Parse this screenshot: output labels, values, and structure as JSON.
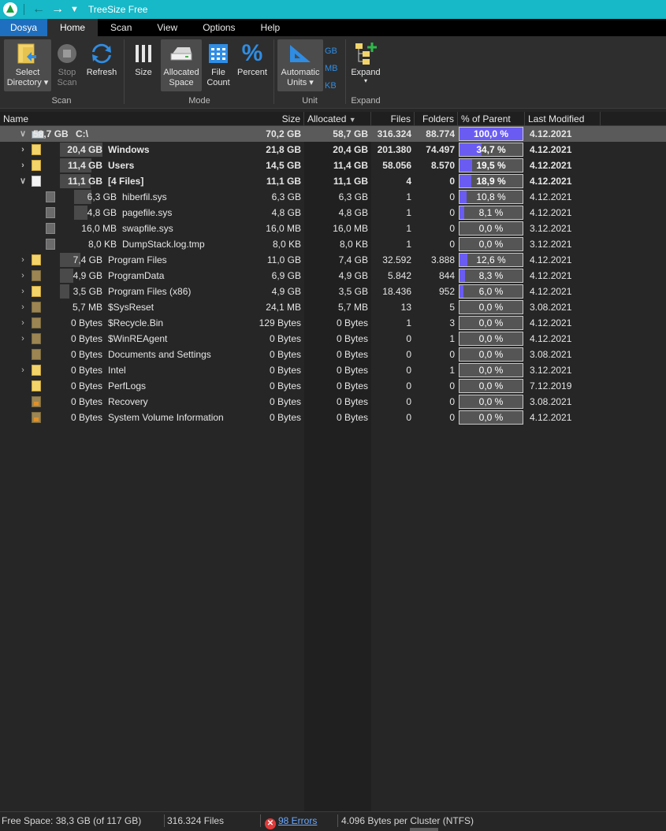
{
  "window": {
    "title": "TreeSize Free"
  },
  "ribbon_tabs": [
    {
      "label": "Dosya"
    },
    {
      "label": "Home"
    },
    {
      "label": "Scan"
    },
    {
      "label": "View"
    },
    {
      "label": "Options"
    },
    {
      "label": "Help"
    }
  ],
  "ribbon": {
    "select_directory": "Select Directory",
    "select_directory_l1": "Select",
    "select_directory_l2": "Directory ▾",
    "stop_scan_l1": "Stop",
    "stop_scan_l2": "Scan",
    "refresh": "Refresh",
    "size": "Size",
    "allocated_l1": "Allocated",
    "allocated_l2": "Space",
    "file_count_l1": "File",
    "file_count_l2": "Count",
    "percent": "Percent",
    "auto_units_l1": "Automatic",
    "auto_units_l2": "Units ▾",
    "unit_gb": "GB",
    "unit_mb": "MB",
    "unit_kb": "KB",
    "expand": "Expand",
    "expand_arrow": "▾",
    "groups": {
      "scan": "Scan",
      "mode": "Mode",
      "unit": "Unit",
      "expand": "Expand"
    }
  },
  "columns": {
    "name": "Name",
    "size": "Size",
    "allocated": "Allocated",
    "allocated_sort": "▼",
    "files": "Files",
    "folders": "Folders",
    "percent": "% of Parent ...",
    "modified": "Last Modified"
  },
  "rows": [
    {
      "arrow": "v",
      "icon": "drive-icon",
      "alloc_label": "58,7 GB",
      "name": "C:\\",
      "size": "70,2 GB",
      "allocated": "58,7 GB",
      "files": "316.324",
      "folders": "88.774",
      "pct_text": "100,0 %",
      "pct": 100.0,
      "modified": "4.12.2021"
    },
    {
      "arrow": ">",
      "icon": "folder-icon",
      "alloc_label": "20,4 GB",
      "name": "Windows",
      "size": "21,8 GB",
      "allocated": "20,4 GB",
      "files": "201.380",
      "folders": "74.497",
      "pct_text": "34,7 %",
      "pct": 34.7,
      "modified": "4.12.2021"
    },
    {
      "arrow": ">",
      "icon": "folder-icon",
      "alloc_label": "11,4 GB",
      "name": "Users",
      "size": "14,5 GB",
      "allocated": "11,4 GB",
      "files": "58.056",
      "folders": "8.570",
      "pct_text": "19,5 %",
      "pct": 19.5,
      "modified": "4.12.2021"
    },
    {
      "arrow": "v",
      "icon": "file-icon",
      "alloc_label": "11,1 GB",
      "name": "[4 Files]",
      "size": "11,1 GB",
      "allocated": "11,1 GB",
      "files": "4",
      "folders": "0",
      "pct_text": "18,9 %",
      "pct": 18.9,
      "modified": "4.12.2021"
    },
    {
      "arrow": "",
      "icon": "system-file-icon",
      "alloc_label": "6,3 GB",
      "name": "hiberfil.sys",
      "size": "6,3 GB",
      "allocated": "6,3 GB",
      "files": "1",
      "folders": "0",
      "pct_text": "10,8 %",
      "pct": 10.8,
      "modified": "4.12.2021"
    },
    {
      "arrow": "",
      "icon": "system-file-icon",
      "alloc_label": "4,8 GB",
      "name": "pagefile.sys",
      "size": "4,8 GB",
      "allocated": "4,8 GB",
      "files": "1",
      "folders": "0",
      "pct_text": "8,1 %",
      "pct": 8.1,
      "modified": "4.12.2021"
    },
    {
      "arrow": "",
      "icon": "system-file-icon",
      "alloc_label": "16,0 MB",
      "name": "swapfile.sys",
      "size": "16,0 MB",
      "allocated": "16,0 MB",
      "files": "1",
      "folders": "0",
      "pct_text": "0,0 %",
      "pct": 0.0,
      "modified": "3.12.2021"
    },
    {
      "arrow": "",
      "icon": "system-file-icon",
      "alloc_label": "8,0 KB",
      "name": "DumpStack.log.tmp",
      "size": "8,0 KB",
      "allocated": "8,0 KB",
      "files": "1",
      "folders": "0",
      "pct_text": "0,0 %",
      "pct": 0.0,
      "modified": "3.12.2021"
    },
    {
      "arrow": ">",
      "icon": "folder-icon",
      "alloc_label": "7,4 GB",
      "name": "Program Files",
      "size": "11,0 GB",
      "allocated": "7,4 GB",
      "files": "32.592",
      "folders": "3.888",
      "pct_text": "12,6 %",
      "pct": 12.6,
      "modified": "4.12.2021"
    },
    {
      "arrow": ">",
      "icon": "folder-dark-icon",
      "alloc_label": "4,9 GB",
      "name": "ProgramData",
      "size": "6,9 GB",
      "allocated": "4,9 GB",
      "files": "5.842",
      "folders": "844",
      "pct_text": "8,3 %",
      "pct": 8.3,
      "modified": "4.12.2021"
    },
    {
      "arrow": ">",
      "icon": "folder-icon",
      "alloc_label": "3,5 GB",
      "name": "Program Files (x86)",
      "size": "4,9 GB",
      "allocated": "3,5 GB",
      "files": "18.436",
      "folders": "952",
      "pct_text": "6,0 %",
      "pct": 6.0,
      "modified": "4.12.2021"
    },
    {
      "arrow": ">",
      "icon": "folder-dark-icon",
      "alloc_label": "5,7 MB",
      "name": "$SysReset",
      "size": "24,1 MB",
      "allocated": "5,7 MB",
      "files": "13",
      "folders": "5",
      "pct_text": "0,0 %",
      "pct": 0.0,
      "modified": "3.08.2021"
    },
    {
      "arrow": ">",
      "icon": "folder-dark-icon",
      "alloc_label": "0 Bytes",
      "name": "$Recycle.Bin",
      "size": "129 Bytes",
      "allocated": "0 Bytes",
      "files": "1",
      "folders": "3",
      "pct_text": "0,0 %",
      "pct": 0.0,
      "modified": "4.12.2021"
    },
    {
      "arrow": ">",
      "icon": "folder-dark-icon",
      "alloc_label": "0 Bytes",
      "name": "$WinREAgent",
      "size": "0 Bytes",
      "allocated": "0 Bytes",
      "files": "0",
      "folders": "1",
      "pct_text": "0,0 %",
      "pct": 0.0,
      "modified": "4.12.2021"
    },
    {
      "arrow": "",
      "icon": "shortcut-folder-icon",
      "alloc_label": "0 Bytes",
      "name": "Documents and Settings",
      "size": "0 Bytes",
      "allocated": "0 Bytes",
      "files": "0",
      "folders": "0",
      "pct_text": "0,0 %",
      "pct": 0.0,
      "modified": "3.08.2021"
    },
    {
      "arrow": ">",
      "icon": "folder-icon",
      "alloc_label": "0 Bytes",
      "name": "Intel",
      "size": "0 Bytes",
      "allocated": "0 Bytes",
      "files": "0",
      "folders": "1",
      "pct_text": "0,0 %",
      "pct": 0.0,
      "modified": "3.12.2021"
    },
    {
      "arrow": "",
      "icon": "folder-icon",
      "alloc_label": "0 Bytes",
      "name": "PerfLogs",
      "size": "0 Bytes",
      "allocated": "0 Bytes",
      "files": "0",
      "folders": "0",
      "pct_text": "0,0 %",
      "pct": 0.0,
      "modified": "7.12.2019"
    },
    {
      "arrow": "",
      "icon": "locked-folder-icon",
      "alloc_label": "0 Bytes",
      "name": "Recovery",
      "size": "0 Bytes",
      "allocated": "0 Bytes",
      "files": "0",
      "folders": "0",
      "pct_text": "0,0 %",
      "pct": 0.0,
      "modified": "3.08.2021"
    },
    {
      "arrow": "",
      "icon": "locked-folder-icon",
      "alloc_label": "0 Bytes",
      "name": "System Volume Information",
      "size": "0 Bytes",
      "allocated": "0 Bytes",
      "files": "0",
      "folders": "0",
      "pct_text": "0,0 %",
      "pct": 0.0,
      "modified": "4.12.2021"
    }
  ],
  "status": {
    "free_space": "Free Space: 38,3 GB  (of 117 GB)",
    "files": "316.324 Files",
    "errors": "98 Errors",
    "cluster": "4.096 Bytes per Cluster (NTFS)"
  },
  "colors": {
    "title_bar": "#17b8c7",
    "file_tab": "#1e6fbf",
    "percent_fill": "#6a5cf2",
    "row_highlight": "#5a5a5a",
    "background": "#262626"
  }
}
